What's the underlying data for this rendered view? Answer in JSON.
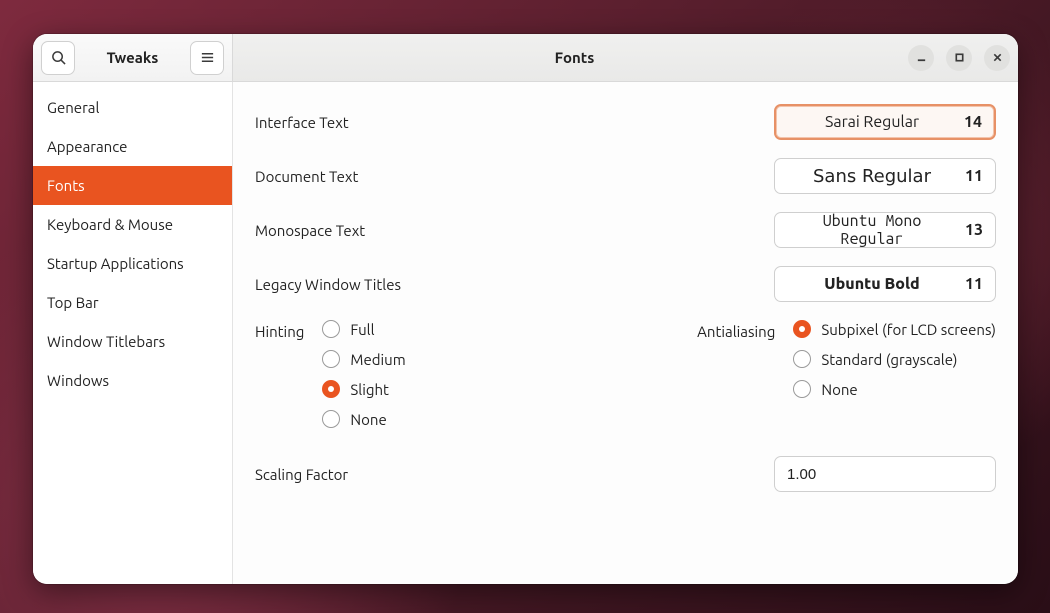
{
  "app": {
    "title": "Tweaks",
    "pane_title": "Fonts"
  },
  "sidebar": {
    "items": [
      {
        "label": "General"
      },
      {
        "label": "Appearance"
      },
      {
        "label": "Fonts"
      },
      {
        "label": "Keyboard & Mouse"
      },
      {
        "label": "Startup Applications"
      },
      {
        "label": "Top Bar"
      },
      {
        "label": "Window Titlebars"
      },
      {
        "label": "Windows"
      }
    ],
    "active_index": 2
  },
  "fonts": {
    "interface": {
      "label": "Interface Text",
      "name": "Sarai Regular",
      "size": "14"
    },
    "document": {
      "label": "Document Text",
      "name": "Sans Regular",
      "size": "11"
    },
    "monospace": {
      "label": "Monospace Text",
      "name": "Ubuntu Mono Regular",
      "size": "13"
    },
    "legacy": {
      "label": "Legacy Window Titles",
      "name": "Ubuntu Bold",
      "size": "11"
    }
  },
  "hinting": {
    "label": "Hinting",
    "options": [
      "Full",
      "Medium",
      "Slight",
      "None"
    ],
    "selected": "Slight"
  },
  "antialiasing": {
    "label": "Antialiasing",
    "options": [
      "Subpixel (for LCD screens)",
      "Standard (grayscale)",
      "None"
    ],
    "selected": "Subpixel (for LCD screens)"
  },
  "scaling": {
    "label": "Scaling Factor",
    "value": "1.00"
  },
  "colors": {
    "accent": "#e95420"
  }
}
